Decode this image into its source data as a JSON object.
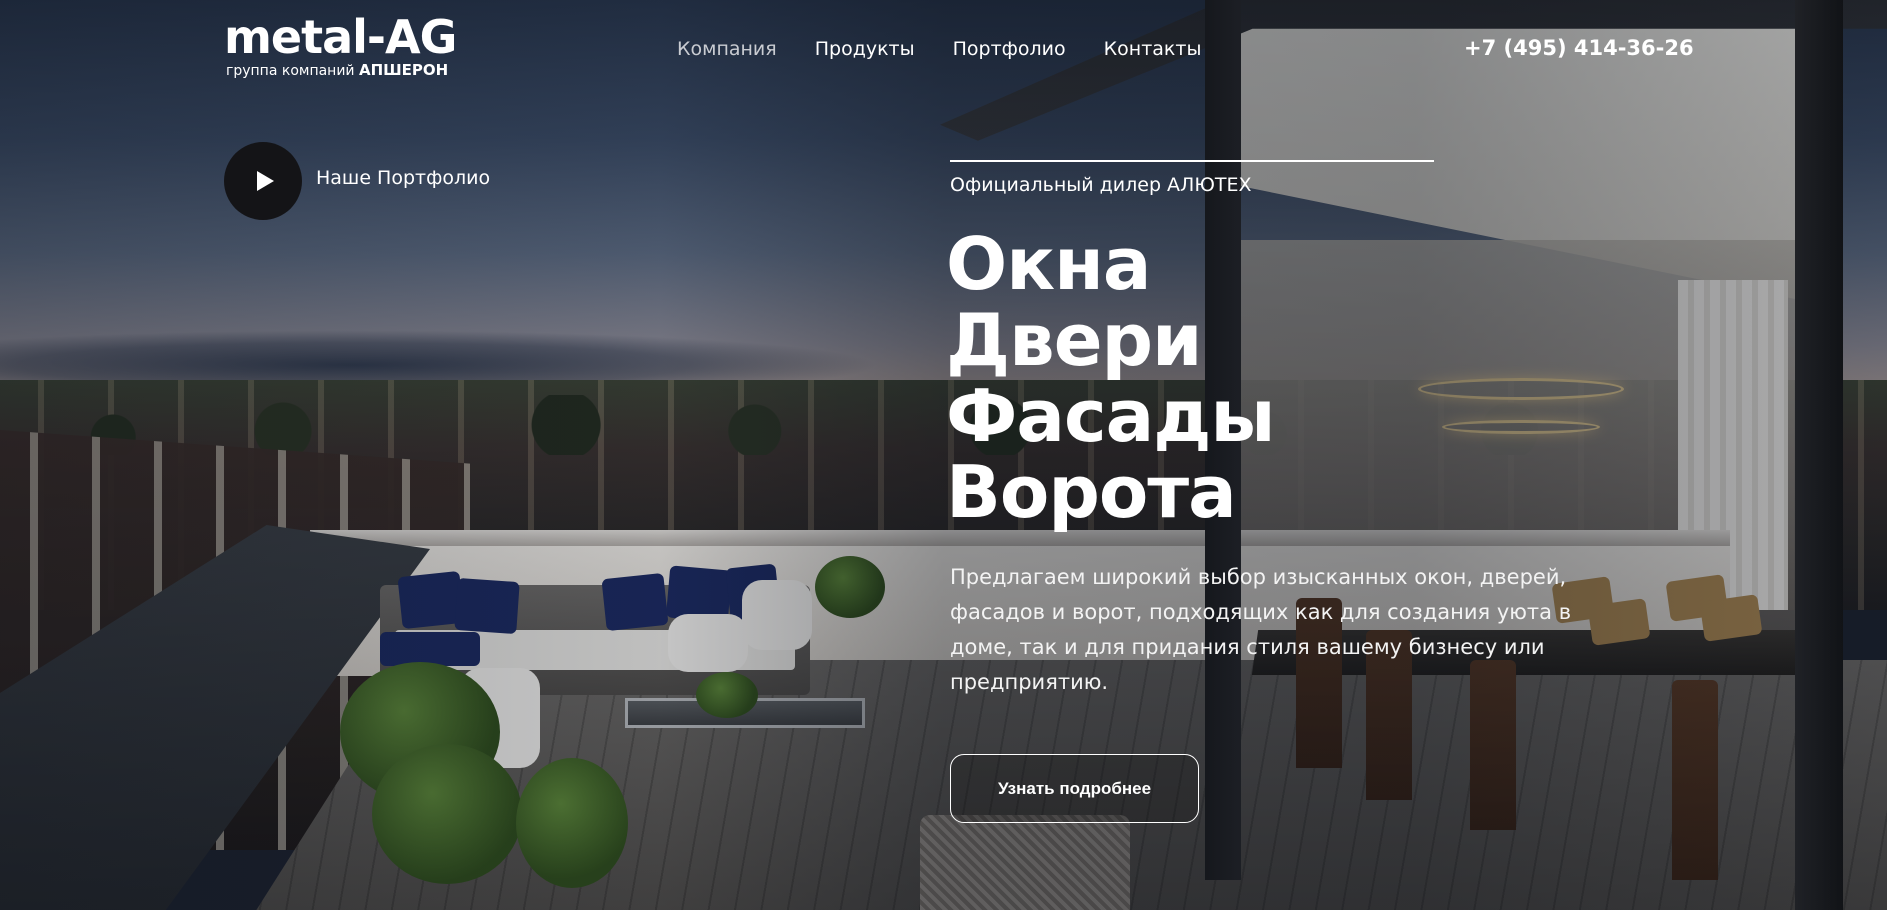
{
  "brand": {
    "logo_main": "metal-AG",
    "logo_sub_prefix": "группа компаний",
    "logo_sub_name": "АПШЕРОН"
  },
  "nav": {
    "items": [
      {
        "label": "Компания",
        "active": true
      },
      {
        "label": "Продукты",
        "active": false
      },
      {
        "label": "Портфолио",
        "active": false
      },
      {
        "label": "Контакты",
        "active": false
      }
    ]
  },
  "phone": "+7 (495) 414-36-26",
  "portfolio": {
    "label": "Наше Портфолио",
    "icon": "play-icon"
  },
  "hero": {
    "dealer": "Официальный дилер АЛЮТЕХ",
    "headline": [
      "Окна",
      "Двери",
      "Фасады",
      "Ворота"
    ],
    "description": "Предлагаем широкий выбор изысканных окон, дверей, фасадов и ворот, подходящих как для создания уюта в доме, так и для придания стиля вашему бизнесу или предприятию.",
    "cta_label": "Узнать подробнее"
  },
  "colors": {
    "text": "#ffffff",
    "nav_active": "#c9ccd2",
    "play_button": "#141417"
  }
}
